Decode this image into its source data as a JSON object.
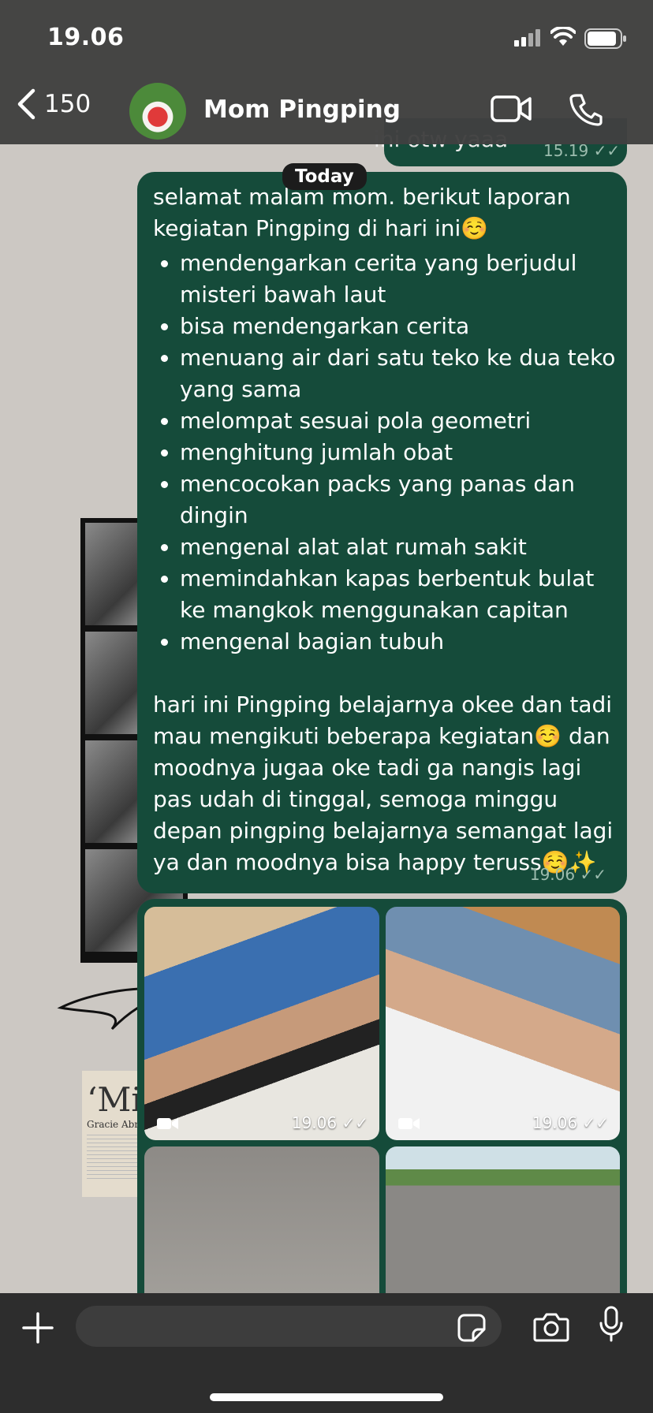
{
  "status_bar": {
    "time": "19.06"
  },
  "header": {
    "back_count": "150",
    "contact_name": "Mom Pingping"
  },
  "chat": {
    "previous_message": {
      "text": "ini otw yaaa",
      "time": "15.19"
    },
    "date_divider": "Today",
    "message": {
      "intro": "selamat malam mom. berikut laporan kegiatan Pingping di hari ini☺️",
      "items": [
        "mendengarkan cerita yang berjudul misteri bawah laut",
        "bisa mendengarkan cerita",
        "menuang air dari satu teko ke dua teko yang sama",
        "melompat sesuai pola geometri",
        "menghitung jumlah obat",
        "mencocokan packs yang panas dan dingin",
        "mengenal alat alat rumah sakit",
        "memindahkan kapas berbentuk bulat ke mangkok menggunakan capitan",
        "mengenal bagian tubuh"
      ],
      "closing": "hari ini Pingping belajarnya okee dan tadi mau mengikuti beberapa kegiatan☺️ dan moodnya jugaa oke tadi ga nangis lagi pas udah di tinggal, semoga minggu depan pingping belajarnya semangat lagi ya dan moodnya bisa happy teruss☺️✨",
      "time": "19.06"
    },
    "media": [
      {
        "type": "video",
        "time": "19.06"
      },
      {
        "type": "video",
        "time": "19.06"
      },
      {
        "type": "photo"
      },
      {
        "type": "photo"
      }
    ]
  },
  "wallpaper_text": {
    "clip_big": "‘Mi",
    "clip_small": "Gracie Abr"
  },
  "input": {
    "placeholder": ""
  },
  "colors": {
    "bubble": "#154b3a",
    "header": "#404040",
    "inputbar": "#2d2d2d"
  }
}
